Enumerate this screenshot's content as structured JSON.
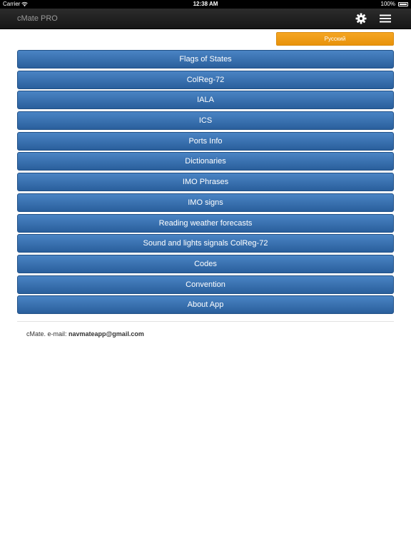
{
  "status_bar": {
    "carrier": "Carrier",
    "time": "12:38 AM",
    "battery": "100%"
  },
  "nav": {
    "title": "cMate PRO",
    "settings_icon": "gear-icon",
    "menu_icon": "hamburger-menu-icon"
  },
  "language_button": "Русский",
  "menu": [
    "Flags of States",
    "ColReg-72",
    "IALA",
    "ICS",
    "Ports Info",
    "Dictionaries",
    "IMO Phrases",
    "IMO signs",
    "Reading weather forecasts",
    "Sound and lights signals ColReg-72",
    "Codes",
    "Convention",
    "About App"
  ],
  "footer": {
    "label": "cMate. e-mail: ",
    "email": "navmateapp@gmail.com"
  },
  "colors": {
    "nav_bg": "#1f1f1f",
    "menu_button": "#3a72b0",
    "language_button": "#f0a01a"
  }
}
